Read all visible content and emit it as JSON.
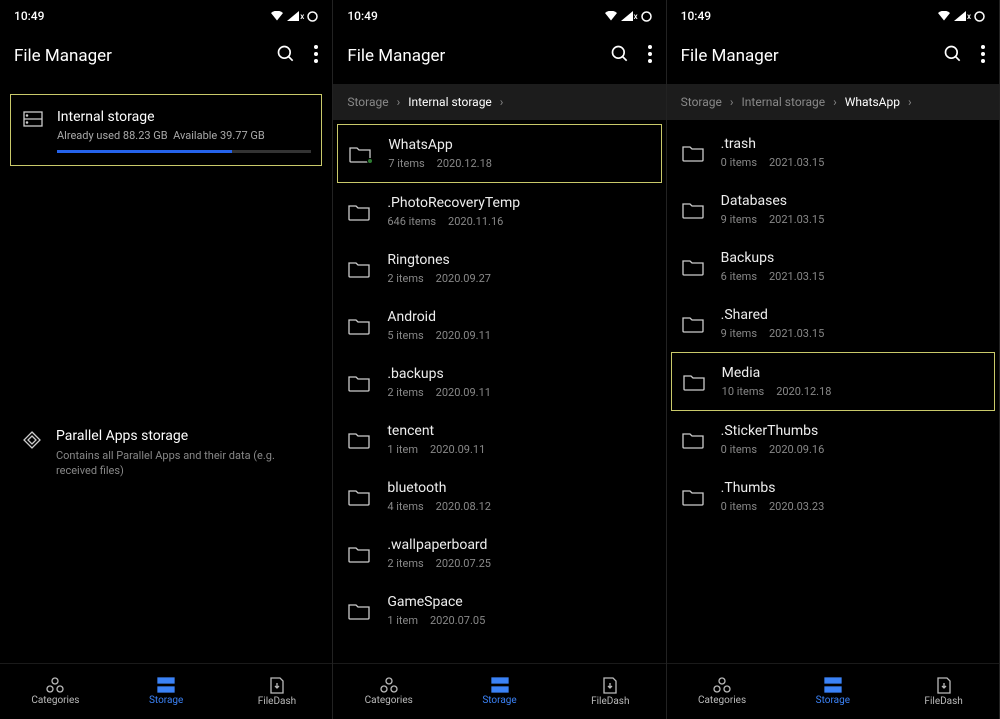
{
  "status": {
    "time": "10:49"
  },
  "appbar": {
    "title": "File Manager"
  },
  "nav": {
    "categories": "Categories",
    "storage": "Storage",
    "filedash": "FileDash"
  },
  "screen1": {
    "internal": {
      "title": "Internal storage",
      "used_label": "Already used 88.23 GB",
      "avail_label": "Available 39.77 GB",
      "used_pct": 69
    },
    "parallel": {
      "title": "Parallel Apps storage",
      "sub": "Contains all Parallel Apps and their data (e.g. received files)"
    }
  },
  "screen2": {
    "breadcrumb": [
      {
        "label": "Storage",
        "active": false
      },
      {
        "label": "Internal storage",
        "active": true
      }
    ],
    "folders": [
      {
        "name": "WhatsApp",
        "items": "7 items",
        "date": "2020.12.18",
        "highlight": true,
        "dot": true
      },
      {
        "name": ".PhotoRecoveryTemp",
        "items": "646 items",
        "date": "2020.11.16"
      },
      {
        "name": "Ringtones",
        "items": "2 items",
        "date": "2020.09.27"
      },
      {
        "name": "Android",
        "items": "5 items",
        "date": "2020.09.11"
      },
      {
        "name": ".backups",
        "items": "2 items",
        "date": "2020.09.11"
      },
      {
        "name": "tencent",
        "items": "1 item",
        "date": "2020.09.11"
      },
      {
        "name": "bluetooth",
        "items": "4 items",
        "date": "2020.08.12"
      },
      {
        "name": ".wallpaperboard",
        "items": "2 items",
        "date": "2020.07.25"
      },
      {
        "name": "GameSpace",
        "items": "1 item",
        "date": "2020.07.05"
      }
    ]
  },
  "screen3": {
    "breadcrumb": [
      {
        "label": "Storage",
        "active": false
      },
      {
        "label": "Internal storage",
        "active": false
      },
      {
        "label": "WhatsApp",
        "active": true
      }
    ],
    "folders": [
      {
        "name": ".trash",
        "items": "0 items",
        "date": "2021.03.15"
      },
      {
        "name": "Databases",
        "items": "9 items",
        "date": "2021.03.15"
      },
      {
        "name": "Backups",
        "items": "6 items",
        "date": "2021.03.15"
      },
      {
        "name": ".Shared",
        "items": "9 items",
        "date": "2021.03.15"
      },
      {
        "name": "Media",
        "items": "10 items",
        "date": "2020.12.18",
        "highlight": true
      },
      {
        "name": ".StickerThumbs",
        "items": "0 items",
        "date": "2020.09.16"
      },
      {
        "name": ".Thumbs",
        "items": "0 items",
        "date": "2020.03.23"
      }
    ]
  }
}
